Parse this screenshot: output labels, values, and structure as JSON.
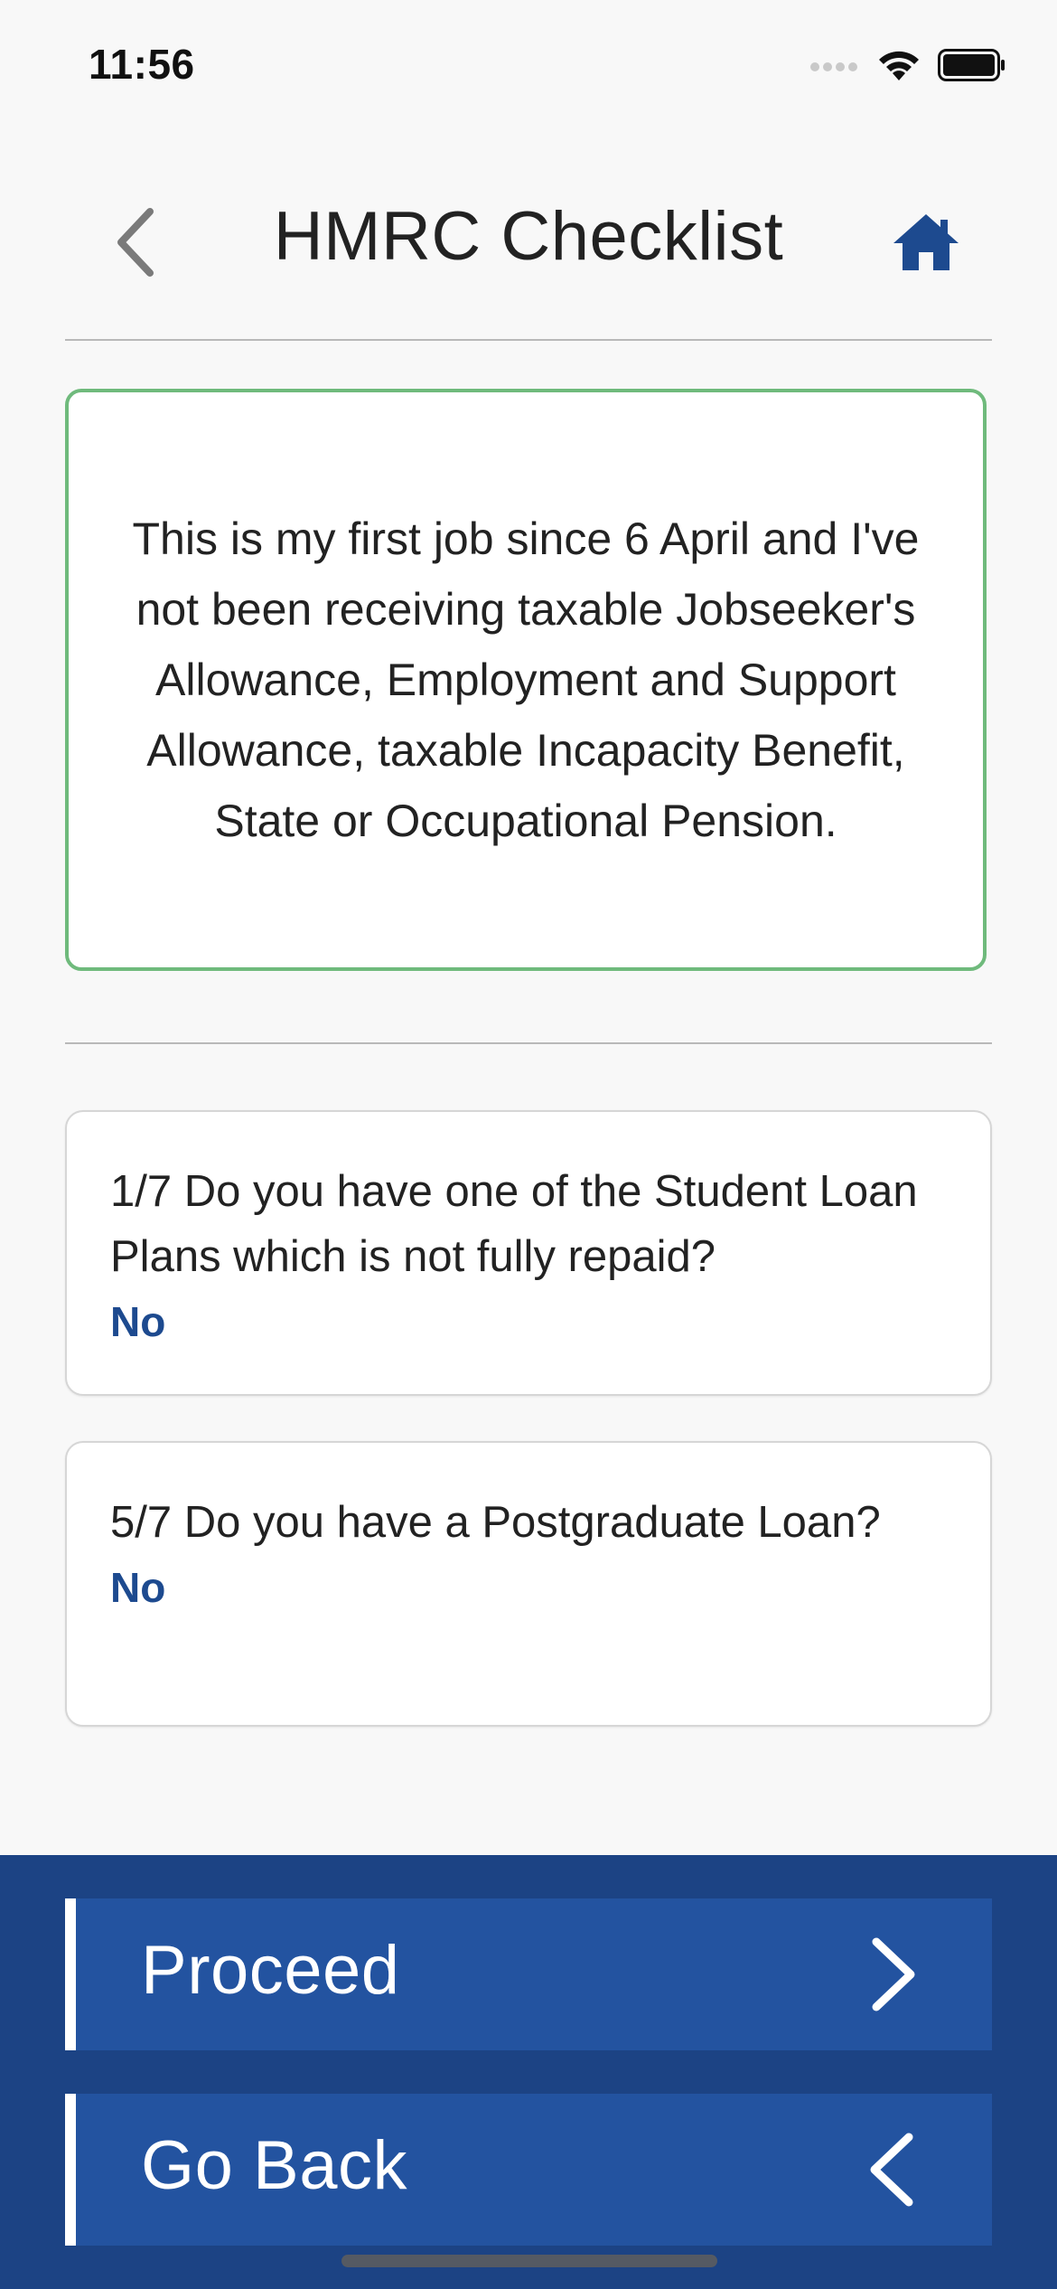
{
  "status_bar": {
    "time": "11:56",
    "icons": [
      "cellular-signal-icon",
      "wifi-icon",
      "battery-icon"
    ]
  },
  "header": {
    "title": "HMRC Checklist",
    "back_icon": "chevron-left-icon",
    "home_icon": "home-icon"
  },
  "summary": {
    "text": "This is my first job since 6 April and I've not been receiving taxable Jobseeker's Allowance, Employment and Support Allowance, taxable Incapacity Benefit, State or Occupational Pension."
  },
  "questions": [
    {
      "text": "1/7 Do you have one of the Student Loan Plans which is not fully repaid?",
      "answer": "No"
    },
    {
      "text": "5/7 Do you have a Postgraduate Loan?",
      "answer": "No"
    }
  ],
  "actions": {
    "proceed_label": "Proceed",
    "go_back_label": "Go Back"
  },
  "colors": {
    "accent_blue": "#1d4a8f",
    "panel_blue": "#1c4384",
    "button_blue": "#2353a0",
    "success_green": "#6fba7c"
  }
}
